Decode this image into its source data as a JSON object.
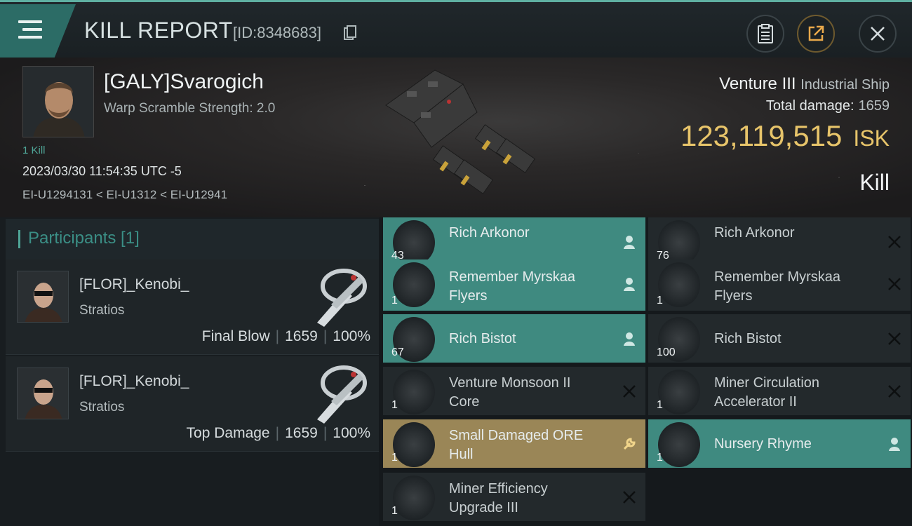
{
  "header": {
    "title": "KILL REPORT",
    "report_id": "[ID:8348683]"
  },
  "victim": {
    "name": "[GALY]Svarogich",
    "warp_scramble": "Warp Scramble Strength: 2.0",
    "kill_count": "1 Kill",
    "datetime": "2023/03/30 11:54:35 UTC -5",
    "route": "EI-U1294131 < EI-U1312 < EI-U12941",
    "ship_name": "Venture III",
    "ship_class": "Industrial Ship",
    "total_damage_label": "Total damage:",
    "total_damage": "1659",
    "isk_value": "123,119,515",
    "isk_currency": "ISK",
    "report_type": "Kill"
  },
  "participants": {
    "title": "Participants [1]",
    "rows": [
      {
        "name": "[FLOR]_Kenobi_",
        "ship": "Stratios",
        "tag": "Final Blow",
        "damage": "1659",
        "percent": "100%"
      },
      {
        "name": "[FLOR]_Kenobi_",
        "ship": "Stratios",
        "tag": "Top Damage",
        "damage": "1659",
        "percent": "100%"
      }
    ]
  },
  "items_left": [
    {
      "qty": "43",
      "name": "Rich Arkonor",
      "status": "dropped"
    },
    {
      "qty": "1",
      "name": "Remember Myrskaa Flyers",
      "status": "dropped"
    },
    {
      "qty": "67",
      "name": "Rich Bistot",
      "status": "dropped"
    },
    {
      "qty": "1",
      "name": "Venture Monsoon II Core",
      "status": "destroyed"
    },
    {
      "qty": "1",
      "name": "Small Damaged ORE Hull",
      "status": "salvage"
    },
    {
      "qty": "1",
      "name": "Miner Efficiency Upgrade III",
      "status": "destroyed"
    }
  ],
  "items_right": [
    {
      "qty": "76",
      "name": "Rich Arkonor",
      "status": "destroyed"
    },
    {
      "qty": "1",
      "name": "Remember Myrskaa Flyers",
      "status": "destroyed"
    },
    {
      "qty": "100",
      "name": "Rich Bistot",
      "status": "destroyed"
    },
    {
      "qty": "1",
      "name": "Miner Circulation Accelerator II",
      "status": "destroyed"
    },
    {
      "qty": "1",
      "name": "Nursery Rhyme",
      "status": "dropped"
    }
  ],
  "colors": {
    "accent": "#4fa597",
    "dropped": "#3f8a80",
    "salvage": "#9a8657",
    "isk": "#e7c46a"
  }
}
